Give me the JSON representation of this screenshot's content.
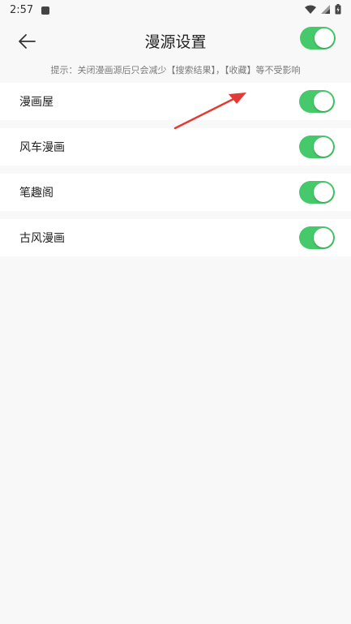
{
  "status_bar": {
    "time": "2:57"
  },
  "header": {
    "title": "漫源设置",
    "master_toggle_on": true
  },
  "hint": "提示：关闭漫画源后只会减少【搜索结果】，【收藏】等不受影响",
  "sources": [
    {
      "name": "漫画屋",
      "enabled": true
    },
    {
      "name": "风车漫画",
      "enabled": true
    },
    {
      "name": "笔趣阁",
      "enabled": true
    },
    {
      "name": "古风漫画",
      "enabled": true
    }
  ],
  "colors": {
    "toggle_on": "#45c96a",
    "annotation_arrow": "#e53935"
  }
}
